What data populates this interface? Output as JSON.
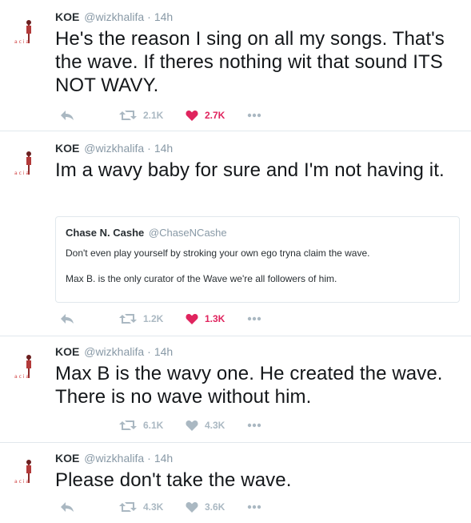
{
  "colors": {
    "like_active": "#e0245e",
    "action_gray": "#aab8c2",
    "meta_gray": "#8899a6",
    "border": "#e1e8ed"
  },
  "tweets": [
    {
      "name": "KOE",
      "handle": "@wizkhalifa",
      "separator": "·",
      "time": "14h",
      "text": "He's the reason I sing on all my songs. That's the wave. If theres nothing wit that sound ITS NOT WAVY.",
      "retweets": "2.1K",
      "likes": "2.7K",
      "liked": true,
      "icons": [
        "reply-icon",
        "retweet-icon",
        "heart-icon",
        "more-icon"
      ]
    },
    {
      "name": "KOE",
      "handle": "@wizkhalifa",
      "separator": "·",
      "time": "14h",
      "text": "Im a wavy baby for sure and I'm not having it.",
      "quote": {
        "name": "Chase N. Cashe",
        "handle": "@ChaseNCashe",
        "line1": "Don't even play yourself by stroking your own ego tryna claim the wave.",
        "line2": "Max B. is the only curator of the Wave we're all followers of him."
      },
      "retweets": "1.2K",
      "likes": "1.3K",
      "liked": true,
      "icons": [
        "reply-icon",
        "retweet-icon",
        "heart-icon",
        "more-icon"
      ]
    },
    {
      "name": "KOE",
      "handle": "@wizkhalifa",
      "separator": "·",
      "time": "14h",
      "text": "Max B is the wavy one. He created the wave. There is no wave without him.",
      "retweets": "6.1K",
      "likes": "4.3K",
      "liked": false,
      "icons": [
        "retweet-icon",
        "heart-icon",
        "more-icon"
      ]
    },
    {
      "name": "KOE",
      "handle": "@wizkhalifa",
      "separator": "·",
      "time": "14h",
      "text": "Please don't take the wave.",
      "retweets": "4.3K",
      "likes": "3.6K",
      "liked": false,
      "icons": [
        "reply-icon",
        "retweet-icon",
        "heart-icon",
        "more-icon"
      ]
    }
  ]
}
